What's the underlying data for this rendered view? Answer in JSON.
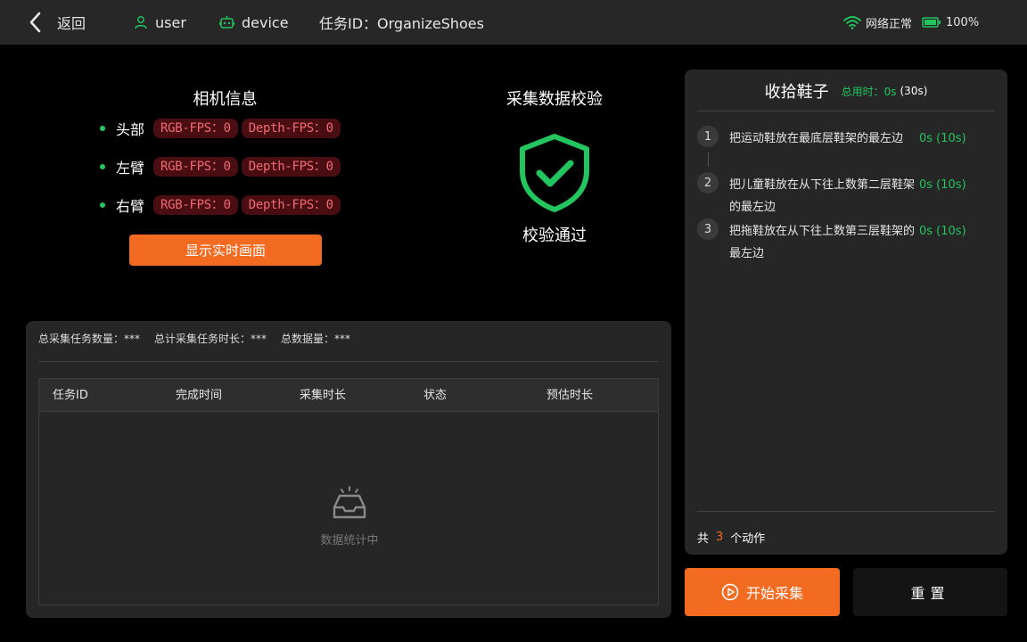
{
  "topbar": {
    "back_label": "返回",
    "user_label": "user",
    "device_label": "device",
    "task_id_label": "任务ID：OrganizeShoes",
    "network_label": "网络正常",
    "battery_label": "100%",
    "accent_green": "#22c55e"
  },
  "camera": {
    "title": "相机信息",
    "rows": [
      {
        "name": "头部",
        "rgb": "RGB-FPS：0",
        "depth": "Depth-FPS：0"
      },
      {
        "name": "左臂",
        "rgb": "RGB-FPS：0",
        "depth": "Depth-FPS：0"
      },
      {
        "name": "右臂",
        "rgb": "RGB-FPS：0",
        "depth": "Depth-FPS：0"
      }
    ],
    "show_button": "显示实时画面"
  },
  "verify": {
    "title": "采集数据校验",
    "status": "校验通过",
    "icon": "shield-check-icon"
  },
  "stats": {
    "total_tasks": "总采集任务数量：***",
    "total_duration": "总计采集任务时长：***",
    "total_data": "总数据量：***",
    "columns": [
      "任务ID",
      "完成时间",
      "采集时长",
      "状态",
      "预估时长"
    ],
    "empty_text": "数据统计中"
  },
  "task_panel": {
    "title": "收拾鞋子",
    "time_used": "总用时：0s",
    "time_limit": "(30s)",
    "steps": [
      {
        "num": "1",
        "text": "把运动鞋放在最底层鞋架的最左边",
        "time": "0s (10s)"
      },
      {
        "num": "2",
        "text": "把儿童鞋放在从下往上数第二层鞋架的最左边",
        "time": "0s (10s)"
      },
      {
        "num": "3",
        "text": "把拖鞋放在从下往上数第三层鞋架的最左边",
        "time": "0s (10s)"
      }
    ],
    "count_prefix": "共",
    "count_value": "3",
    "count_suffix": "个动作"
  },
  "buttons": {
    "start": "开始采集",
    "reset": "重置"
  },
  "colors": {
    "accent_orange": "#f26b21",
    "card_bg": "#262626",
    "fps_tag_bg": "#4a0d12",
    "fps_tag_text": "#f06a72"
  }
}
